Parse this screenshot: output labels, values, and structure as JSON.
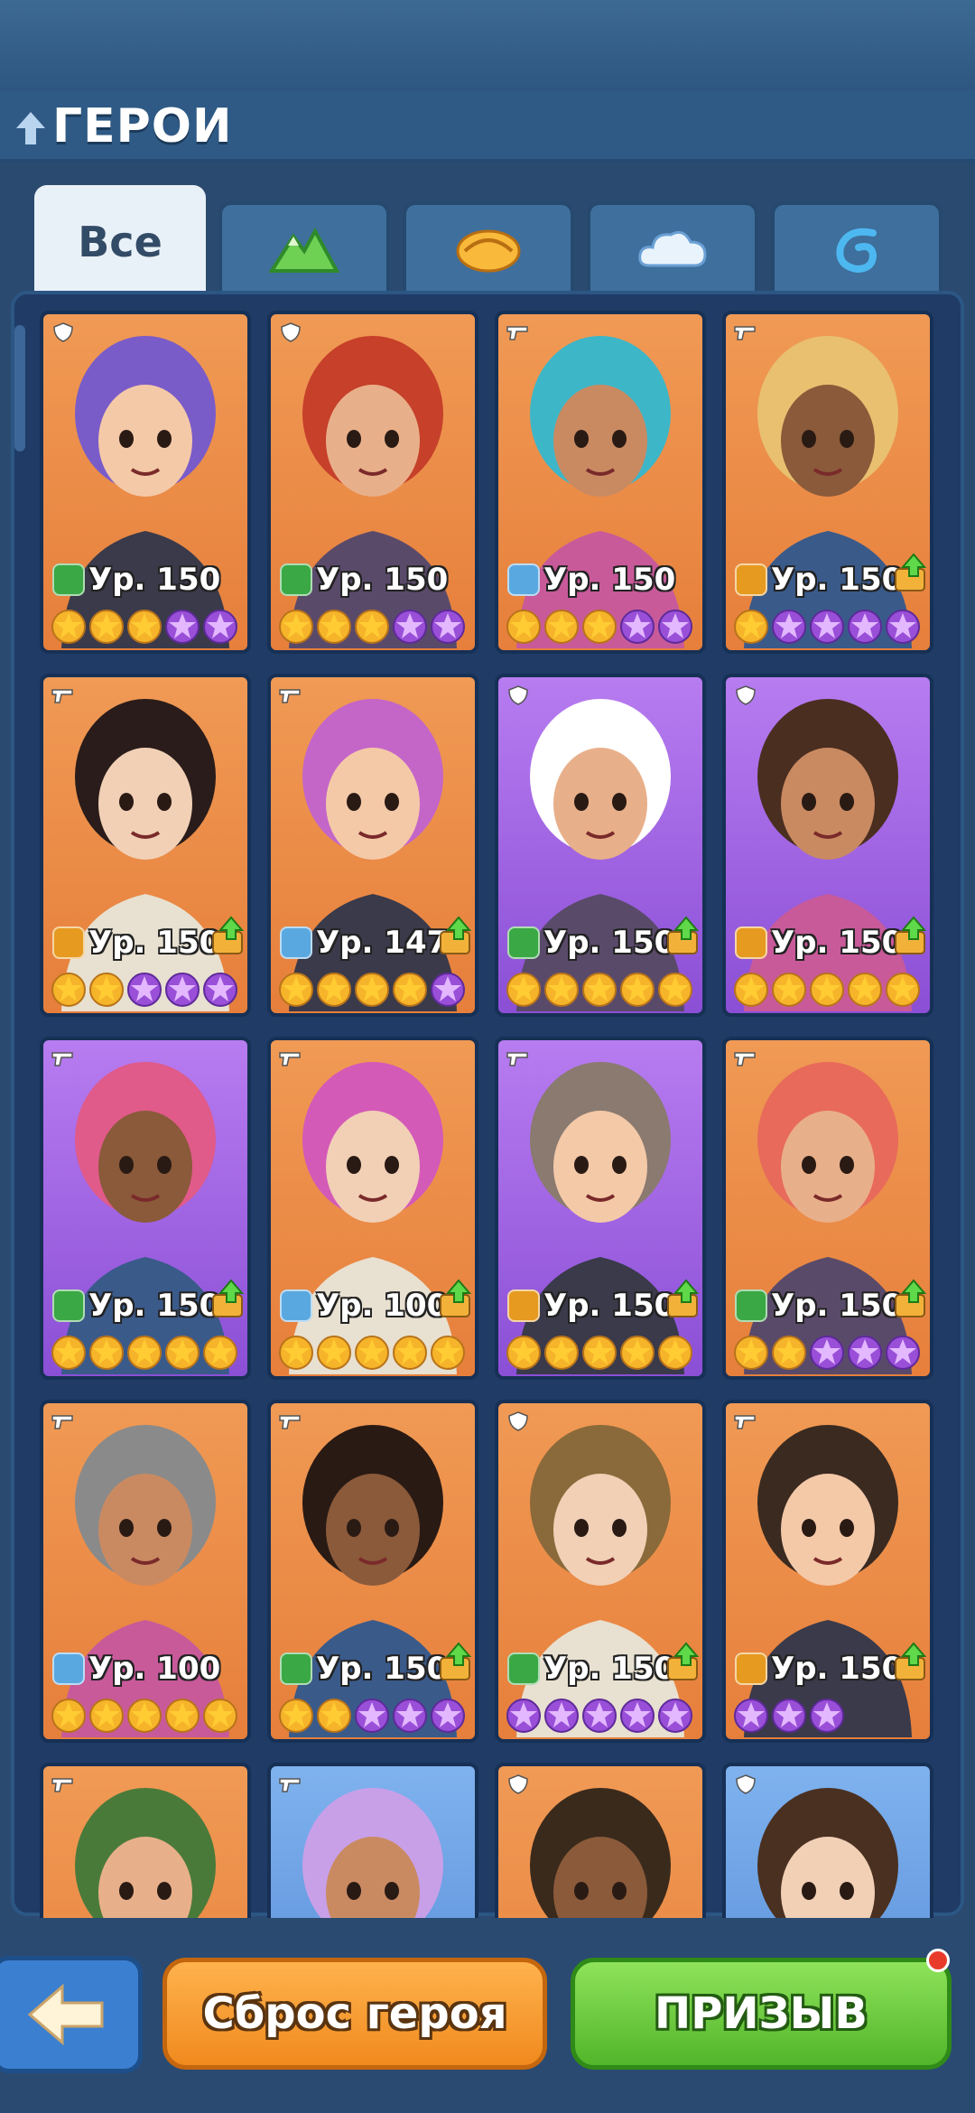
{
  "header": {
    "title": "ГЕРОИ"
  },
  "tabs": [
    {
      "label": "Все",
      "icon": "all"
    },
    {
      "label": "",
      "icon": "mountain-icon"
    },
    {
      "label": "",
      "icon": "sun-icon"
    },
    {
      "label": "",
      "icon": "cloud-icon"
    },
    {
      "label": "",
      "icon": "wave-icon"
    }
  ],
  "colors": {
    "orange": "#e67f3b",
    "purple": "#8b4fd6",
    "blue": "#4f86d4",
    "gold_star": "#ffcc33",
    "purple_star": "#b06ae8"
  },
  "heroes": [
    {
      "level": "Ур. 150",
      "bg": "orange",
      "element": "mountain",
      "role": "shield",
      "stars_gold": 3,
      "stars_purple": 2,
      "upgrade": false
    },
    {
      "level": "Ур. 150",
      "bg": "orange",
      "element": "mountain",
      "role": "shield",
      "stars_gold": 3,
      "stars_purple": 2,
      "upgrade": false
    },
    {
      "level": "Ур. 150",
      "bg": "orange",
      "element": "cloud",
      "role": "gun",
      "stars_gold": 3,
      "stars_purple": 2,
      "upgrade": false
    },
    {
      "level": "Ур. 150",
      "bg": "orange",
      "element": "sun",
      "role": "gun",
      "stars_gold": 1,
      "stars_purple": 4,
      "upgrade": true
    },
    {
      "level": "Ур. 150",
      "bg": "orange",
      "element": "sun",
      "role": "gun",
      "stars_gold": 2,
      "stars_purple": 3,
      "upgrade": true
    },
    {
      "level": "Ур. 147",
      "bg": "orange",
      "element": "cloud",
      "role": "gun",
      "stars_gold": 4,
      "stars_purple": 1,
      "upgrade": true
    },
    {
      "level": "Ур. 150",
      "bg": "purple",
      "element": "mountain",
      "role": "shield",
      "stars_gold": 5,
      "stars_purple": 0,
      "upgrade": true
    },
    {
      "level": "Ур. 150",
      "bg": "purple",
      "element": "sun",
      "role": "shield",
      "stars_gold": 5,
      "stars_purple": 0,
      "upgrade": true
    },
    {
      "level": "Ур. 150",
      "bg": "purple",
      "element": "mountain",
      "role": "gun",
      "stars_gold": 5,
      "stars_purple": 0,
      "upgrade": true
    },
    {
      "level": "Ур. 100",
      "bg": "orange",
      "element": "cloud",
      "role": "gun",
      "stars_gold": 5,
      "stars_purple": 0,
      "upgrade": true
    },
    {
      "level": "Ур. 150",
      "bg": "purple",
      "element": "sun",
      "role": "gun",
      "stars_gold": 5,
      "stars_purple": 0,
      "upgrade": true
    },
    {
      "level": "Ур. 150",
      "bg": "orange",
      "element": "mountain",
      "role": "gun",
      "stars_gold": 2,
      "stars_purple": 3,
      "upgrade": true
    },
    {
      "level": "Ур. 100",
      "bg": "orange",
      "element": "cloud",
      "role": "gun",
      "stars_gold": 5,
      "stars_purple": 0,
      "upgrade": false
    },
    {
      "level": "Ур. 150",
      "bg": "orange",
      "element": "mountain",
      "role": "gun",
      "stars_gold": 2,
      "stars_purple": 3,
      "upgrade": true
    },
    {
      "level": "Ур. 150",
      "bg": "orange",
      "element": "mountain",
      "role": "shield",
      "stars_gold": 0,
      "stars_purple": 5,
      "upgrade": true
    },
    {
      "level": "Ур. 150",
      "bg": "orange",
      "element": "sun",
      "role": "gun",
      "stars_gold": 0,
      "stars_purple": 3,
      "upgrade": true
    },
    {
      "level": "",
      "bg": "orange",
      "element": "",
      "role": "gun",
      "stars_gold": 0,
      "stars_purple": 0,
      "upgrade": false
    },
    {
      "level": "",
      "bg": "blue",
      "element": "",
      "role": "gun",
      "stars_gold": 0,
      "stars_purple": 0,
      "upgrade": false
    },
    {
      "level": "",
      "bg": "orange",
      "element": "",
      "role": "shield",
      "stars_gold": 0,
      "stars_purple": 0,
      "upgrade": false
    },
    {
      "level": "",
      "bg": "blue",
      "element": "",
      "role": "shield",
      "stars_gold": 0,
      "stars_purple": 0,
      "upgrade": false
    }
  ],
  "buttons": {
    "back_icon": "arrow-left-icon",
    "reset": "Сброс героя",
    "summon": "ПРИЗЫВ"
  }
}
